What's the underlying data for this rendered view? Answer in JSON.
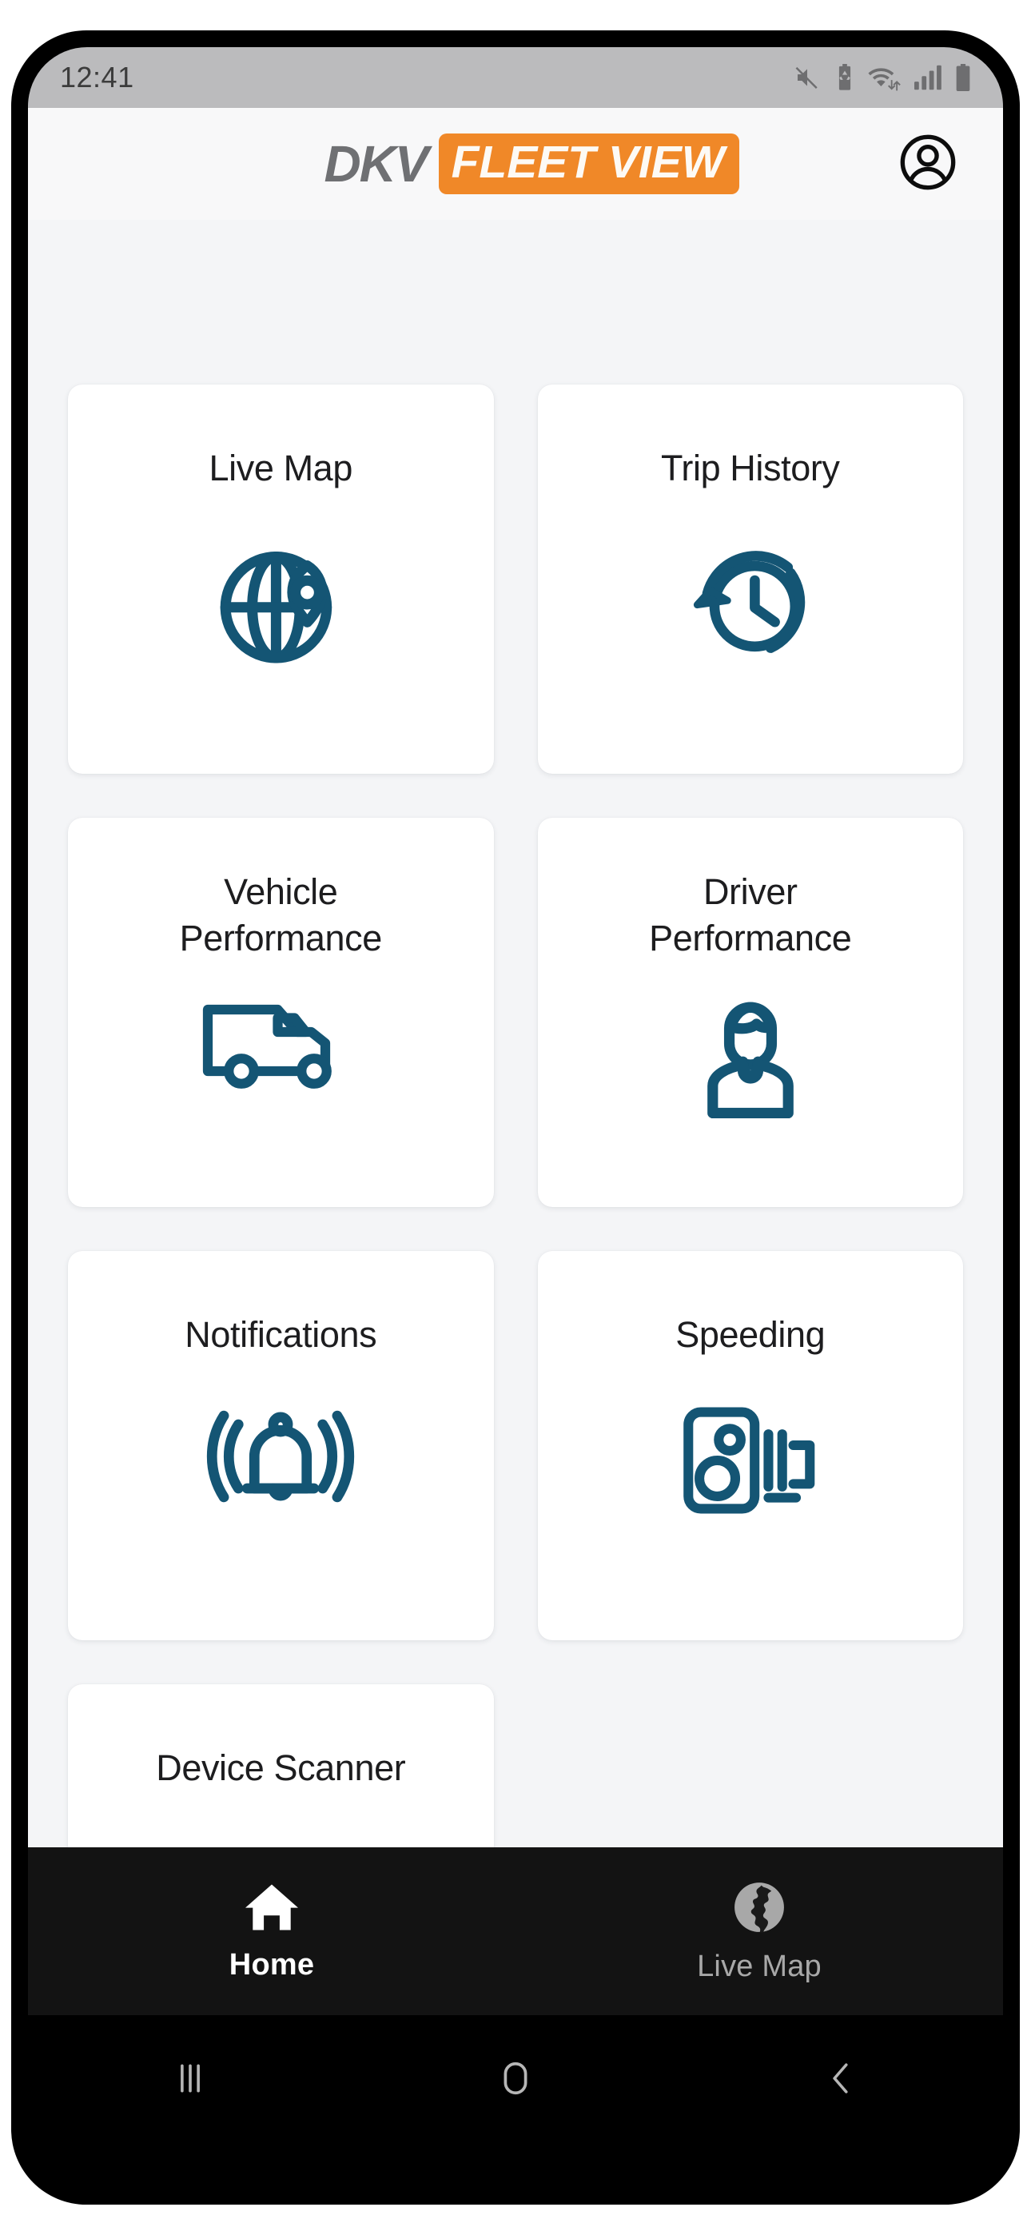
{
  "status_bar": {
    "time": "12:41",
    "icons": [
      "mute-icon",
      "battery-saver-icon",
      "wifi-icon",
      "cellular-signal-icon",
      "battery-icon"
    ]
  },
  "header": {
    "brand_primary": "DKV",
    "brand_secondary": "FLEET VIEW",
    "brand_accent_color": "#f08828",
    "brand_primary_color": "#6f7073",
    "account_icon": "account-circle-icon"
  },
  "main": {
    "tiles": [
      {
        "label": "Live Map",
        "icon": "globe-pin-icon",
        "lines": 1
      },
      {
        "label": "Trip History",
        "icon": "history-clock-icon",
        "lines": 1
      },
      {
        "label": "Vehicle\nPerformance",
        "icon": "van-icon",
        "lines": 2,
        "line1": "Vehicle",
        "line2": "Performance"
      },
      {
        "label": "Driver\nPerformance",
        "icon": "driver-person-icon",
        "lines": 2,
        "line1": "Driver",
        "line2": "Performance"
      },
      {
        "label": "Notifications",
        "icon": "ringing-bell-icon",
        "lines": 1
      },
      {
        "label": "Speeding",
        "icon": "speed-camera-icon",
        "lines": 1
      },
      {
        "label": "Device Scanner",
        "icon": "scanner-icon",
        "lines": 1
      }
    ],
    "icon_color": "#145574"
  },
  "bottom_nav": {
    "items": [
      {
        "label": "Home",
        "icon": "home-icon",
        "active": true
      },
      {
        "label": "Live Map",
        "icon": "earth-icon",
        "active": false
      }
    ],
    "active_color": "#ffffff",
    "inactive_color": "#a8a8a8",
    "background_color": "#131313"
  },
  "system_nav": {
    "buttons": [
      {
        "name": "recent-apps",
        "icon": "recent-apps-icon"
      },
      {
        "name": "home",
        "icon": "system-home-icon"
      },
      {
        "name": "back",
        "icon": "back-chevron-icon"
      }
    ]
  }
}
